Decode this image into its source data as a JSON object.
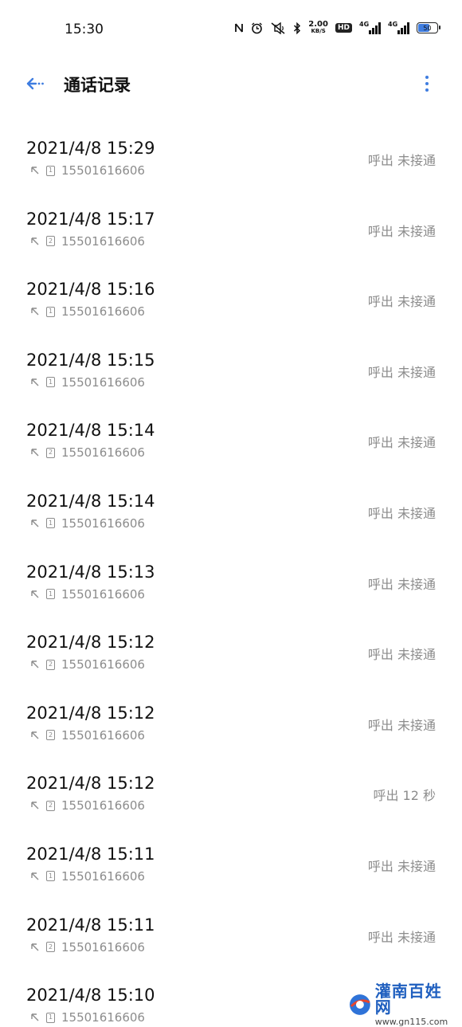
{
  "status_bar": {
    "time": "15:30",
    "net_speed": "2.00",
    "net_unit": "KB/S",
    "hd": "HD",
    "signal1_label": "4G",
    "signal2_label": "4G",
    "battery": "50"
  },
  "header": {
    "title": "通话记录",
    "back_icon": "back-arrow-icon",
    "more_icon": "more-vertical-icon",
    "accent": "#3f7de0"
  },
  "calls": [
    {
      "time": "2021/4/8 15:29",
      "sim": "1",
      "number": "15501616606",
      "status": "呼出 未接通"
    },
    {
      "time": "2021/4/8 15:17",
      "sim": "2",
      "number": "15501616606",
      "status": "呼出 未接通"
    },
    {
      "time": "2021/4/8 15:16",
      "sim": "1",
      "number": "15501616606",
      "status": "呼出 未接通"
    },
    {
      "time": "2021/4/8 15:15",
      "sim": "1",
      "number": "15501616606",
      "status": "呼出 未接通"
    },
    {
      "time": "2021/4/8 15:14",
      "sim": "2",
      "number": "15501616606",
      "status": "呼出 未接通"
    },
    {
      "time": "2021/4/8 15:14",
      "sim": "1",
      "number": "15501616606",
      "status": "呼出 未接通"
    },
    {
      "time": "2021/4/8 15:13",
      "sim": "1",
      "number": "15501616606",
      "status": "呼出 未接通"
    },
    {
      "time": "2021/4/8 15:12",
      "sim": "2",
      "number": "15501616606",
      "status": "呼出 未接通"
    },
    {
      "time": "2021/4/8 15:12",
      "sim": "2",
      "number": "15501616606",
      "status": "呼出 未接通"
    },
    {
      "time": "2021/4/8 15:12",
      "sim": "2",
      "number": "15501616606",
      "status": "呼出  12 秒"
    },
    {
      "time": "2021/4/8 15:11",
      "sim": "1",
      "number": "15501616606",
      "status": "呼出 未接通"
    },
    {
      "time": "2021/4/8 15:11",
      "sim": "2",
      "number": "15501616606",
      "status": "呼出 未接通"
    },
    {
      "time": "2021/4/8 15:10",
      "sim": "1",
      "number": "15501616606",
      "status": ""
    }
  ],
  "watermark": {
    "name": "灌南百姓网",
    "url": "www.gn115.com"
  }
}
